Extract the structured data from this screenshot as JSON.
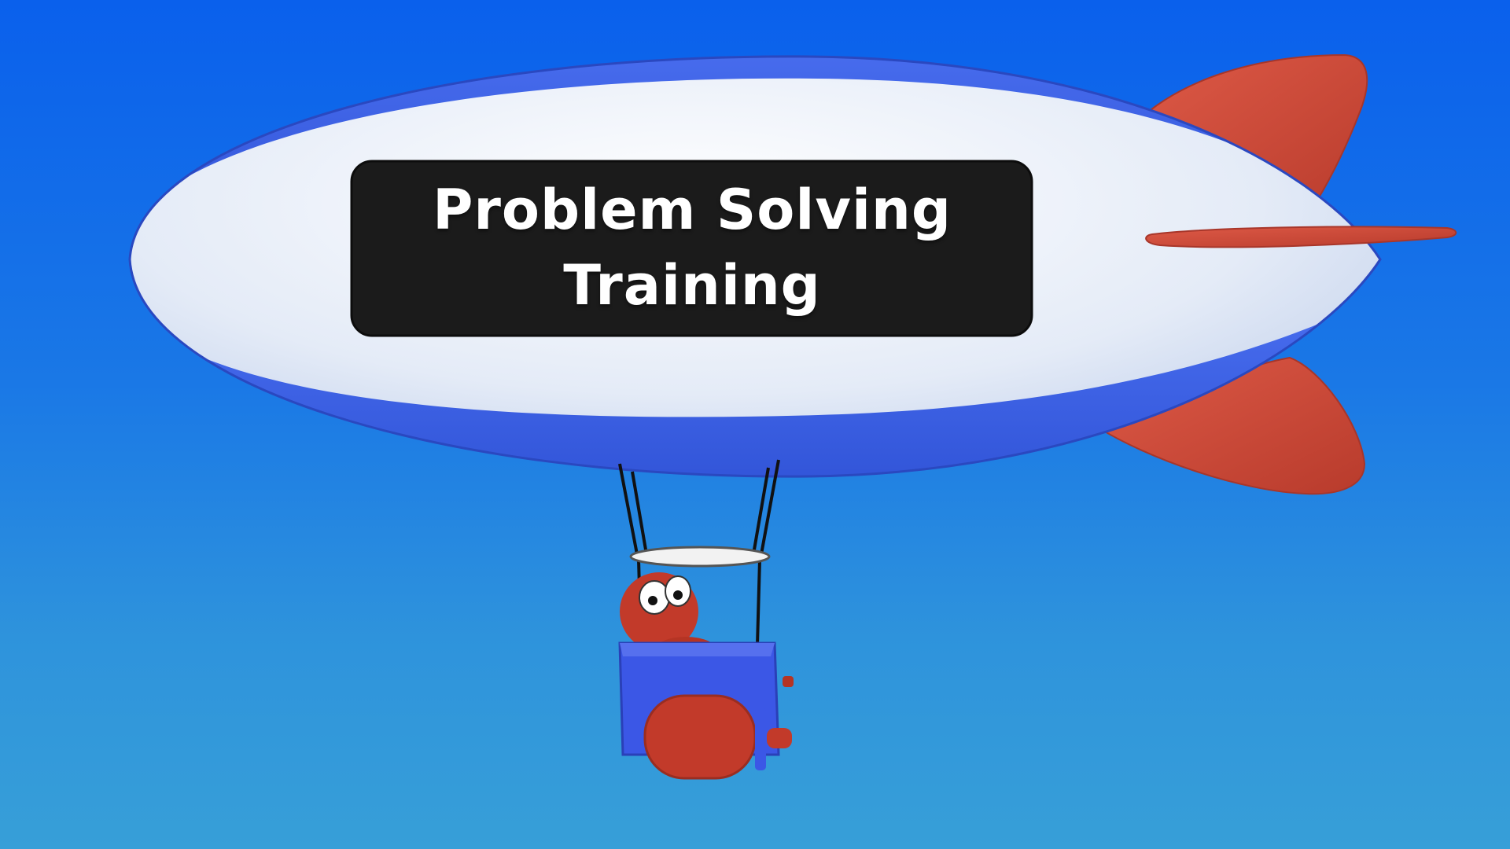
{
  "banner": {
    "line1": "Problem Solving",
    "line2": "Training"
  },
  "colors": {
    "sky_top": "#0a60ec",
    "sky_bottom": "#379fd8",
    "envelope_white": "#e6edf8",
    "envelope_stripe": "#3a62e0",
    "fin_red": "#cf4a3a",
    "banner_black": "#1b1b1b",
    "gondola_blue": "#3b57e6",
    "character_red": "#c23a2a"
  },
  "icons": [
    "blimp-illustration",
    "pilot-character",
    "gondola",
    "propeller-engine"
  ]
}
